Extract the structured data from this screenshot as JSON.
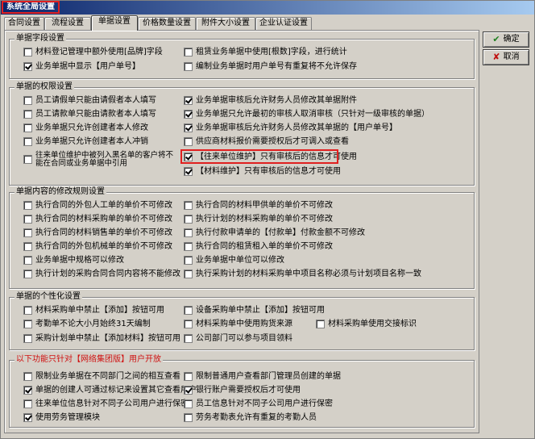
{
  "window": {
    "title": "系统全局设置"
  },
  "tabs": [
    "合同设置",
    "流程设置",
    "单据设置",
    "价格数量设置",
    "附件大小设置",
    "企业认证设置"
  ],
  "active_tab": "单据设置",
  "buttons": {
    "ok": "确定",
    "cancel": "取消"
  },
  "groups": {
    "fields": {
      "title": "单据字段设置",
      "items": [
        {
          "label": "材料登记管理中额外使用[品牌]字段",
          "checked": false
        },
        {
          "label": "租赁业务单据中使用[根数]字段，进行统计",
          "checked": false
        },
        {
          "label": "业务单据中显示【用户单号】",
          "checked": true
        },
        {
          "label": "编制业务单据时用户单号有重复将不允许保存",
          "checked": false
        }
      ]
    },
    "permissions": {
      "title": "单据的权限设置",
      "items": [
        {
          "label": "员工请假单只能由请假者本人填写",
          "checked": false
        },
        {
          "label": "业务单据审核后允许财务人员修改其单据附件",
          "checked": true
        },
        {
          "label": "员工请款单只能由请款者本人填写",
          "checked": false
        },
        {
          "label": "业务单据只允许最初的审核人取消审核（只针对一级审核的单据）",
          "checked": true
        },
        {
          "label": "业务单据只允许创建者本人修改",
          "checked": false
        },
        {
          "label": "业务单据审核后允许财务人员修改其单据的【用户单号】",
          "checked": true
        },
        {
          "label": "业务单据只允许创建者本人冲销",
          "checked": false
        },
        {
          "label": "供应商材料报价需要授权后才可调入或查看",
          "checked": false
        },
        {
          "label": "往来单位维护中被列入黑名单的客户将不能在合同或业务单据中引用",
          "checked": false
        },
        {
          "label": "【往来单位维护】只有审核后的信息才可使用",
          "checked": true
        },
        {
          "label": "【材料维护】只有审核后的信息才可使用",
          "checked": true
        }
      ]
    },
    "edit_rules": {
      "title": "单据内容的修改规则设置",
      "items": [
        {
          "label": "执行合同的外包人工单的单价不可修改",
          "checked": false
        },
        {
          "label": "执行合同的材料甲供单的单价不可修改",
          "checked": false
        },
        {
          "label": "执行合同的材料采购单的单价不可修改",
          "checked": false
        },
        {
          "label": "执行计划的材料采购单的单价不可修改",
          "checked": false
        },
        {
          "label": "执行合同的材料销售单的单价不可修改",
          "checked": false
        },
        {
          "label": "执行付款申请单的【付款单】付款金额不可修改",
          "checked": false
        },
        {
          "label": "执行合同的外包机械单的单价不可修改",
          "checked": false
        },
        {
          "label": "执行合同的租赁租入单的单价不可修改",
          "checked": false
        },
        {
          "label": "业务单据中规格可以修改",
          "checked": false
        },
        {
          "label": "业务单据中单位可以修改",
          "checked": false
        },
        {
          "label": "执行计划的采购合同合同内容将不能修改",
          "checked": false
        },
        {
          "label": "执行采购计划的材料采购单中项目名称必须与计划项目名称一致",
          "checked": false
        }
      ]
    },
    "personal": {
      "title": "单据的个性化设置",
      "items": [
        {
          "label": "材料采购单中禁止【添加】按钮可用",
          "checked": false
        },
        {
          "label": "设备采购单中禁止【添加】按钮可用",
          "checked": false
        },
        {
          "label": "考勤单不论大小月始终31天编制",
          "checked": false
        },
        {
          "label": "材料采购单中使用购货来源",
          "checked": false
        },
        {
          "label": "材料采购单使用交接标识",
          "checked": false
        },
        {
          "label": "采购计划单中禁止【添加材料】按钮可用",
          "checked": false
        },
        {
          "label": "公司部门可以参与项目领料",
          "checked": false
        }
      ]
    },
    "network": {
      "title": "以下功能只针对【网络集团版】用户开放",
      "items": [
        {
          "label": "限制业务单据在不同部门之间的相互查看",
          "checked": false
        },
        {
          "label": "限制普通用户查看部门管理员创建的单据",
          "checked": false
        },
        {
          "label": "单据的创建人可通过标记来设置其它查看用户",
          "checked": true
        },
        {
          "label": "银行账户需要授权后才可使用",
          "checked": true
        },
        {
          "label": "往来单位信息针对不同子公司用户进行保密",
          "checked": false
        },
        {
          "label": "员工信息针对不同子公司用户进行保密",
          "checked": false
        },
        {
          "label": "使用劳务管理模块",
          "checked": true
        },
        {
          "label": "劳务考勤表允许有重复的考勤人员",
          "checked": false
        }
      ]
    }
  }
}
